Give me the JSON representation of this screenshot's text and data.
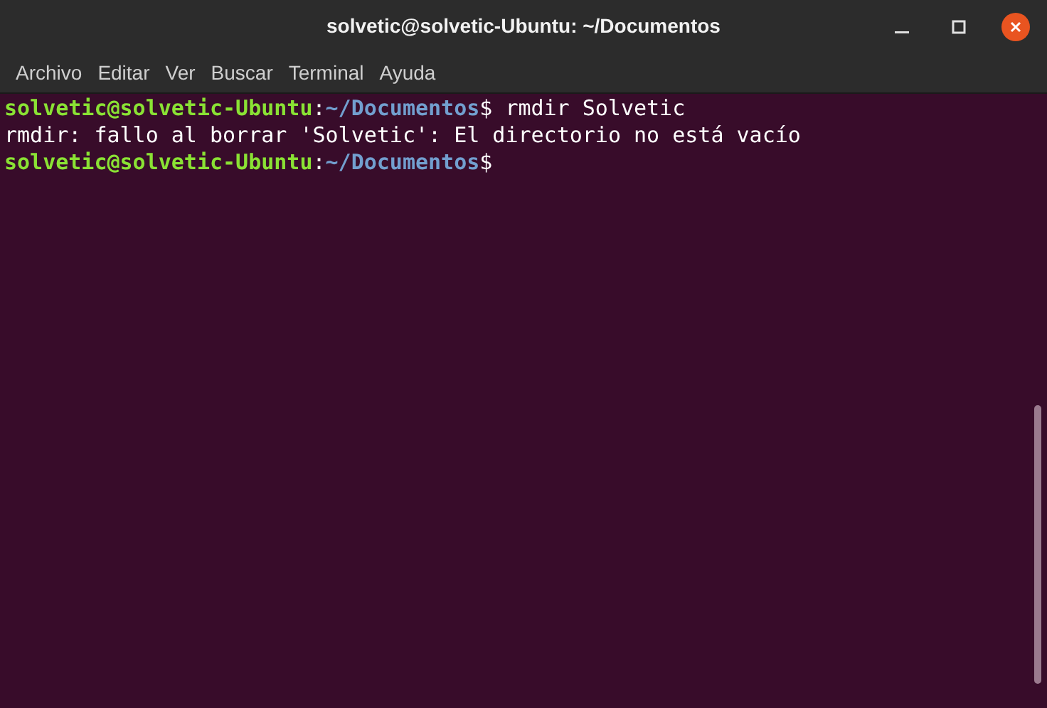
{
  "window": {
    "title": "solvetic@solvetic-Ubuntu: ~/Documentos"
  },
  "menu": [
    "Archivo",
    "Editar",
    "Ver",
    "Buscar",
    "Terminal",
    "Ayuda"
  ],
  "terminal": {
    "lines": [
      {
        "kind": "prompt",
        "user": "solvetic@solvetic-Ubuntu",
        "separator": ":",
        "path": "~/Documentos",
        "symbol": "$",
        "command": "rmdir Solvetic"
      },
      {
        "kind": "output",
        "text": "rmdir: fallo al borrar 'Solvetic': El directorio no está vacío"
      },
      {
        "kind": "prompt",
        "user": "solvetic@solvetic-Ubuntu",
        "separator": ":",
        "path": "~/Documentos",
        "symbol": "$"
      }
    ]
  }
}
